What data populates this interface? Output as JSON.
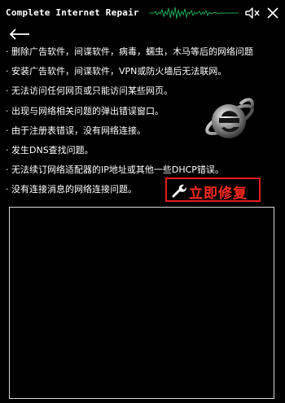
{
  "app": {
    "title": "Complete Internet Repair"
  },
  "issues": [
    "· 删除广告软件，间谍软件，病毒，蠕虫，木马等后的网络问题",
    "· 安装广告软件，间谍软件，VPN或防火墙后无法联网。",
    "· 无法访问任何网页或只能访问某些网页。",
    "· 出现与网络相关问题的弹出错误窗口。",
    "· 由于注册表错误，没有网络连接。",
    "· 发生DNS查找问题。",
    "· 无法续订网络适配器的IP地址或其他一些DHCP错误。",
    "· 没有连接消息的网络连接问题。"
  ],
  "actions": {
    "fix_label": "立即修复"
  },
  "icons": {
    "back": "back-arrow-icon",
    "mute": "volume-mute-icon",
    "close": "close-icon",
    "wrench": "wrench-icon",
    "logo": "internet-explorer-logo-icon"
  },
  "colors": {
    "accent": "#e51b1b",
    "background": "#000000",
    "text": "#ffffff",
    "wave": "#19a85a"
  }
}
